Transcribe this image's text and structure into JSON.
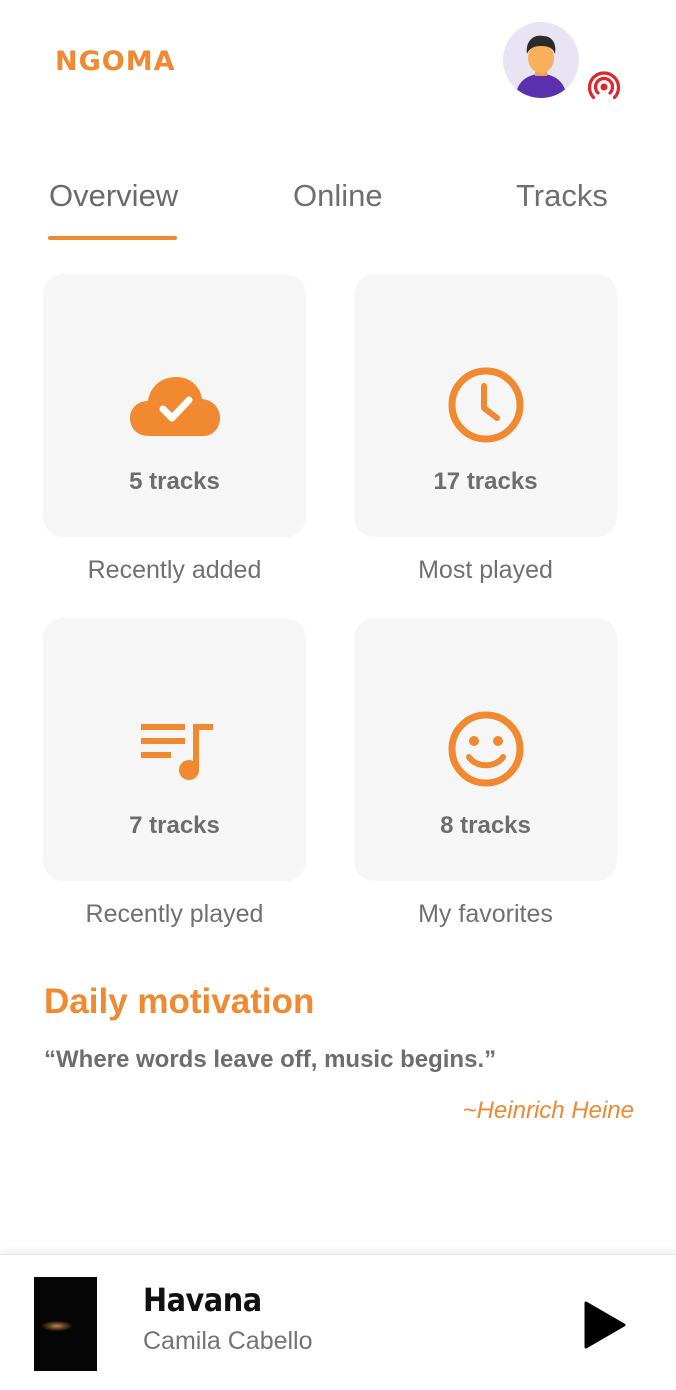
{
  "app": {
    "logo": "NGOMA"
  },
  "header": {
    "avatar_icon": "user-avatar-icon",
    "broadcast_icon": "broadcast-icon"
  },
  "tabs": [
    {
      "label": "Overview",
      "active": true
    },
    {
      "label": "Online",
      "active": false
    },
    {
      "label": "Tracks",
      "active": false
    }
  ],
  "cards": [
    {
      "count": "5 tracks",
      "label": "Recently added",
      "icon": "cloud-check-icon"
    },
    {
      "count": "17 tracks",
      "label": "Most played",
      "icon": "clock-icon"
    },
    {
      "count": "7 tracks",
      "label": "Recently played",
      "icon": "playlist-icon"
    },
    {
      "count": "8 tracks",
      "label": "My favorites",
      "icon": "smiley-icon"
    }
  ],
  "motivation": {
    "title": "Daily motivation",
    "quote": "“Where words leave off, music begins.”",
    "author": "~Heinrich Heine"
  },
  "player": {
    "title": "Havana",
    "artist": "Camila Cabello",
    "play_icon": "play-icon"
  },
  "colors": {
    "accent": "#f0892f",
    "card_bg": "#f6f6f6",
    "live_red": "#e0262c"
  }
}
